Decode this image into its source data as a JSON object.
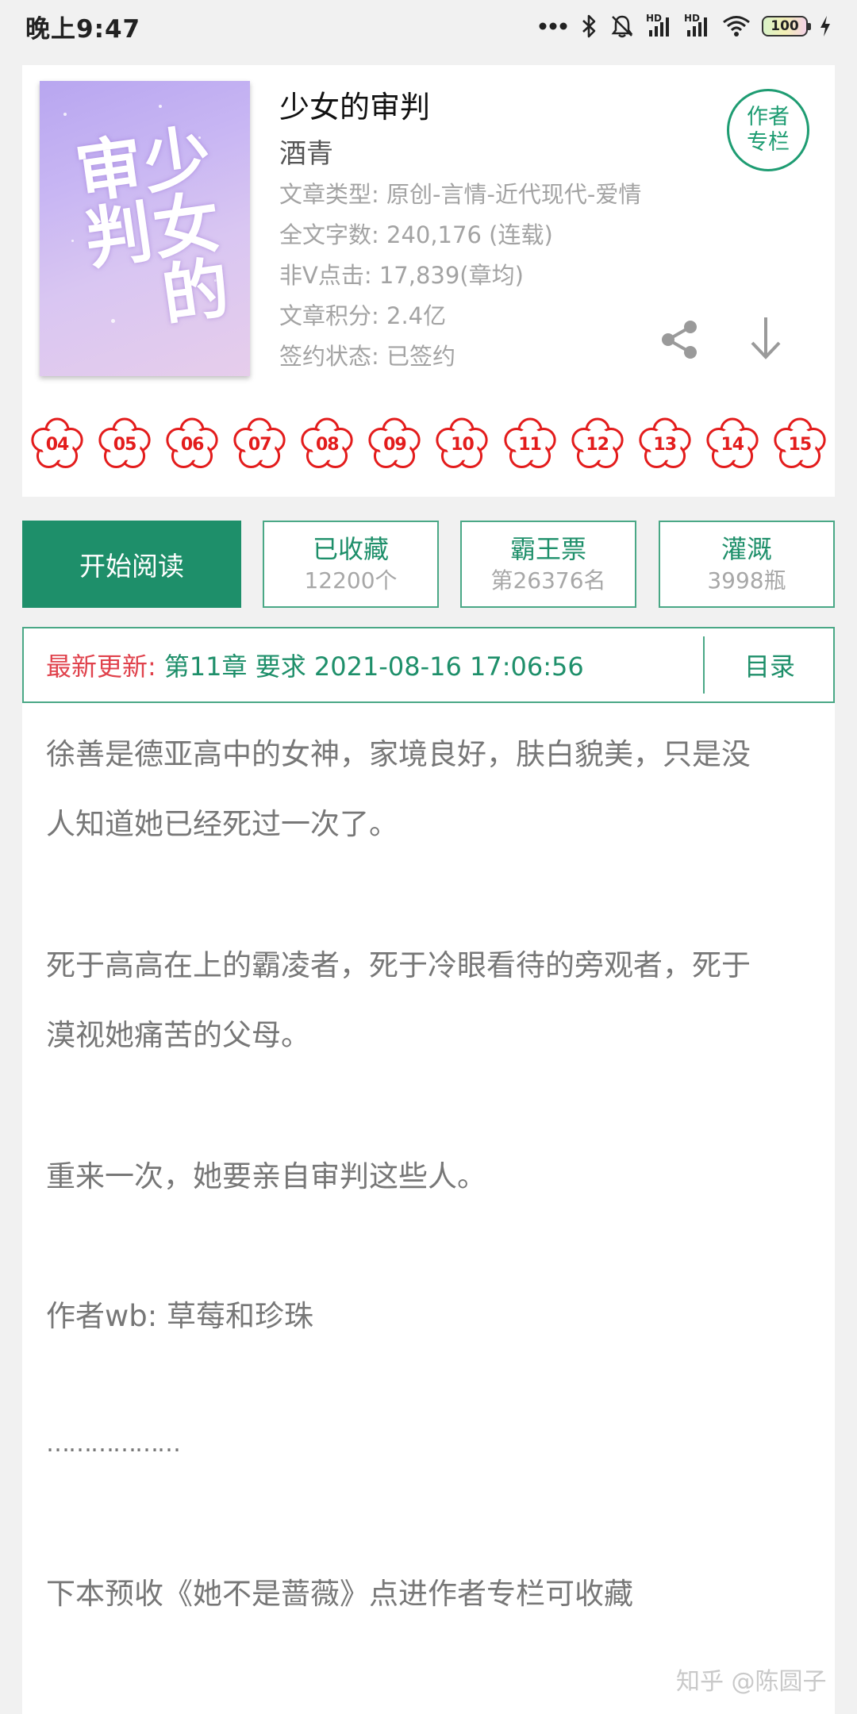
{
  "status_bar": {
    "time": "晚上9:47",
    "hd1": "HD",
    "hd2": "HD",
    "battery": "100",
    "icons": [
      "more-dots-icon",
      "bluetooth-icon",
      "bell-off-icon",
      "signal-icon",
      "signal-icon",
      "wifi-icon",
      "battery-icon",
      "charging-icon"
    ]
  },
  "book": {
    "title": "少女的审判",
    "author": "酒青",
    "cover_text": "少女的审判",
    "meta": [
      "文章类型: 原创-言情-近代现代-爱情",
      "全文字数: 240,176 (连载)",
      "非V点击: 17,839(章均)",
      "文章积分: 2.4亿",
      "签约状态: 已签约"
    ],
    "author_column_label": "作者专栏",
    "months": [
      "04",
      "05",
      "06",
      "07",
      "08",
      "09",
      "10",
      "11",
      "12",
      "13",
      "14",
      "15"
    ]
  },
  "actions": {
    "read": "开始阅读",
    "collect": {
      "label": "已收藏",
      "count": "12200个"
    },
    "ticket": {
      "label": "霸王票",
      "rank": "第26376名"
    },
    "water": {
      "label": "灌溉",
      "count": "3998瓶"
    }
  },
  "update": {
    "label": "最新更新:",
    "text": "第11章  要求  2021-08-16 17:06:56",
    "toc": "目录"
  },
  "description": [
    "徐善是德亚高中的女神，家境良好，肤白貌美，只是没",
    "人知道她已经死过一次了。",
    "死于高高在上的霸凌者，死于冷眼看待的旁观者，死于",
    "漠视她痛苦的父母。",
    "重来一次，她要亲自审判这些人。",
    "作者wb: 草莓和珍珠",
    "………………",
    "下本预收《她不是蔷薇》点进作者专栏可收藏"
  ],
  "watermark": "知乎 @陈圆子",
  "colors": {
    "accent": "#1e8f6a",
    "update_label": "#e0424c",
    "flower": "#e31c1c"
  }
}
